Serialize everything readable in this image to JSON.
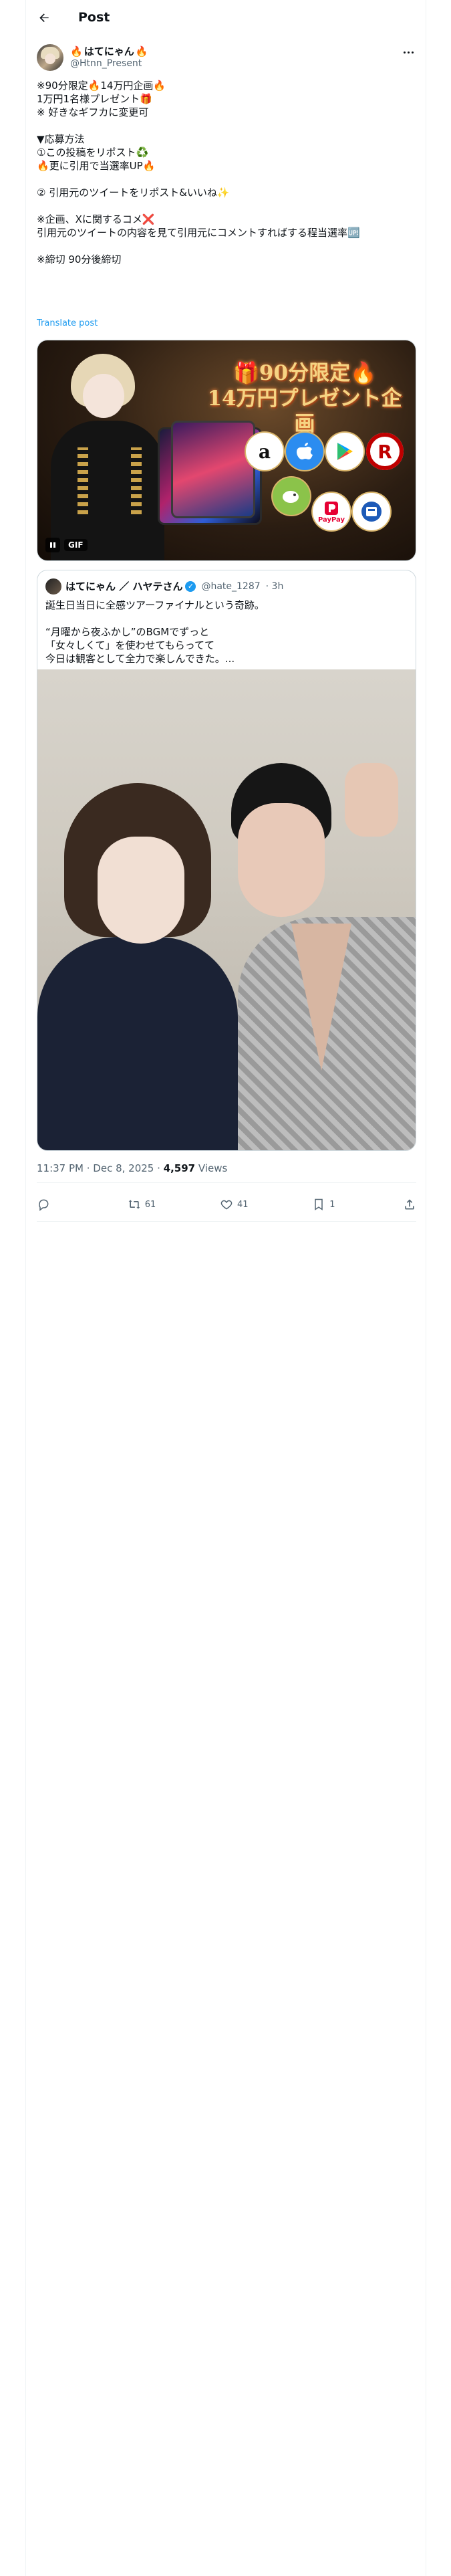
{
  "header": {
    "title": "Post"
  },
  "author": {
    "name_prefix": "🔥",
    "name": "はてにゃん",
    "name_suffix": "🔥",
    "handle": "@Htnn_Present"
  },
  "post": {
    "lines": [
      "※90分限定🔥14万円企画🔥",
      "1万円1名様プレゼント🎁",
      "※ 好きなギフカに変更可",
      "",
      "▼応募方法",
      "①この投稿をリポスト♻️",
      "🔥更に引用で当選率UP🔥",
      "",
      "② 引用元のツイートをリポスト&いいね✨",
      "",
      "※企画、Xに関するコメ❌",
      "引用元のツイートの内容を見て引用元にコメントすればする程当選率🆙",
      "",
      "※締切 90分後締切"
    ],
    "translate_label": "Translate post"
  },
  "media": {
    "title_line1": "🎁90分限定🔥",
    "title_line2": "14万円プレゼント企画",
    "gif_label": "GIF",
    "logo_amazon": "a",
    "logo_rakuten": "R",
    "logo_paypay": "PayPay"
  },
  "quote": {
    "name": "はてにゃん ／ ハヤテさん",
    "handle": "@hate_1287",
    "time": "· 3h",
    "text": "誕生日当日に全感ツアーファイナルという奇跡。\n\n“月曜から夜ふかし”のBGMでずっと\n「女々しくて」を使わせてもらってて\n今日は観客として全力で楽しんできた。..."
  },
  "meta": {
    "time": "11:37 PM · Dec 8, 2025 · ",
    "views_count": "4,597",
    "views_label": " Views"
  },
  "actions": {
    "reply": "",
    "repost": "61",
    "like": "41",
    "bookmark": "1"
  }
}
